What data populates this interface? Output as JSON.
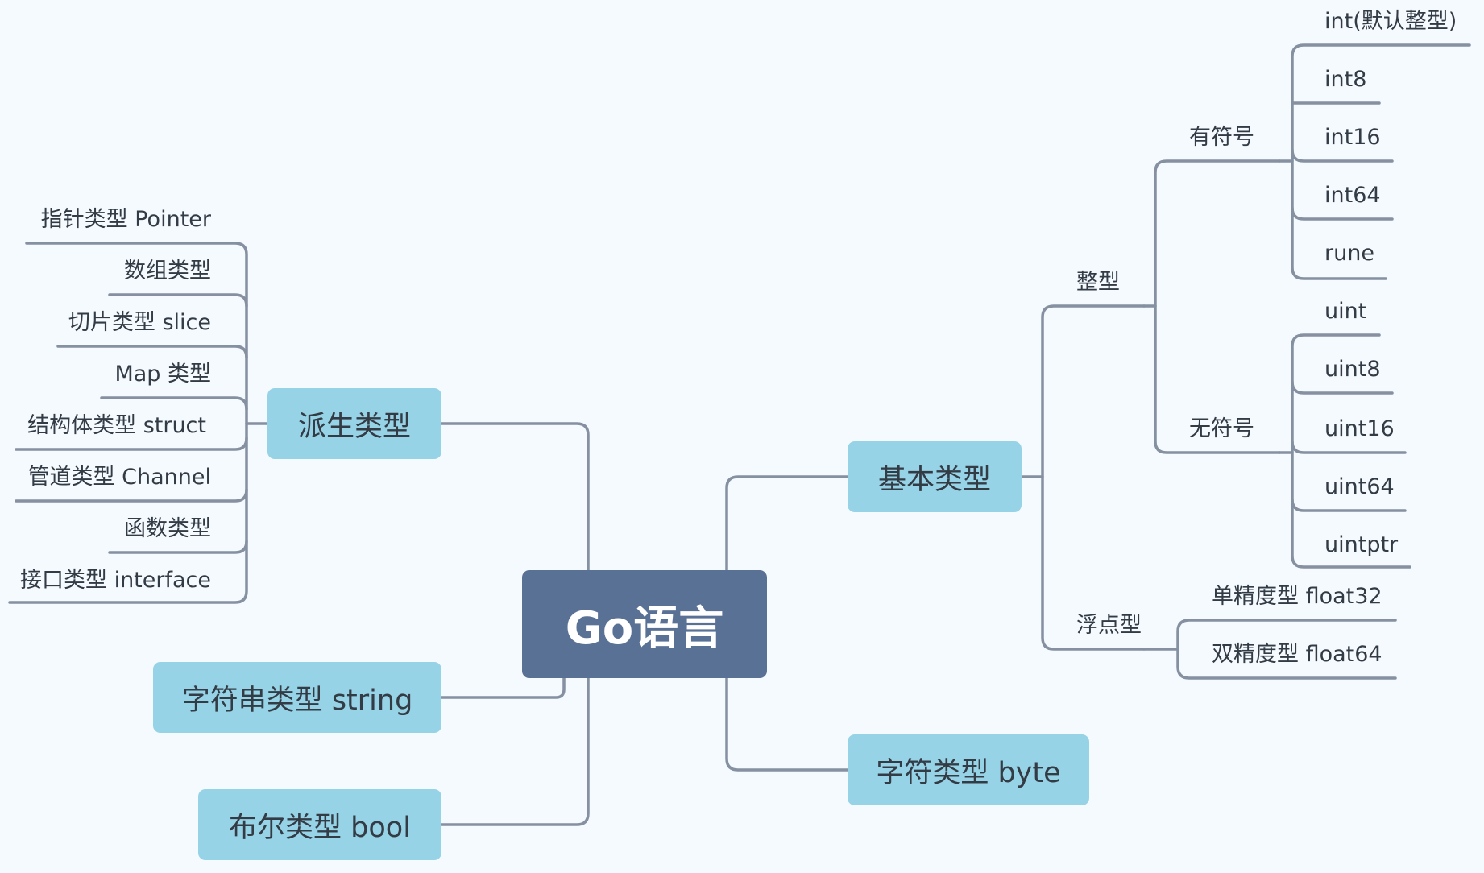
{
  "root": "Go语言",
  "derived": {
    "title": "派生类型",
    "items": [
      "指针类型 Pointer",
      "数组类型",
      "切片类型 slice",
      "Map 类型",
      "结构体类型 struct",
      "管道类型 Channel",
      "函数类型",
      "接口类型 interface"
    ]
  },
  "string_type": "字符串类型 string",
  "bool_type": "布尔类型 bool",
  "basic": {
    "title": "基本类型",
    "integer": {
      "title": "整型",
      "signed": {
        "title": "有符号",
        "items": [
          "int(默认整型)",
          "int8",
          "int16",
          "int64",
          "rune"
        ]
      },
      "unsigned": {
        "title": "无符号",
        "items": [
          "uint",
          "uint8",
          "uint16",
          "uint64",
          "uintptr"
        ]
      }
    },
    "float": {
      "title": "浮点型",
      "items": [
        "单精度型 float32",
        "双精度型 float64"
      ]
    }
  },
  "byte_type": "字符类型 byte",
  "colors": {
    "background": "#f5faff",
    "root_fill": "#5a7196",
    "node_fill": "#97d3e6",
    "line": "#8590a0",
    "text": "#333b45"
  }
}
